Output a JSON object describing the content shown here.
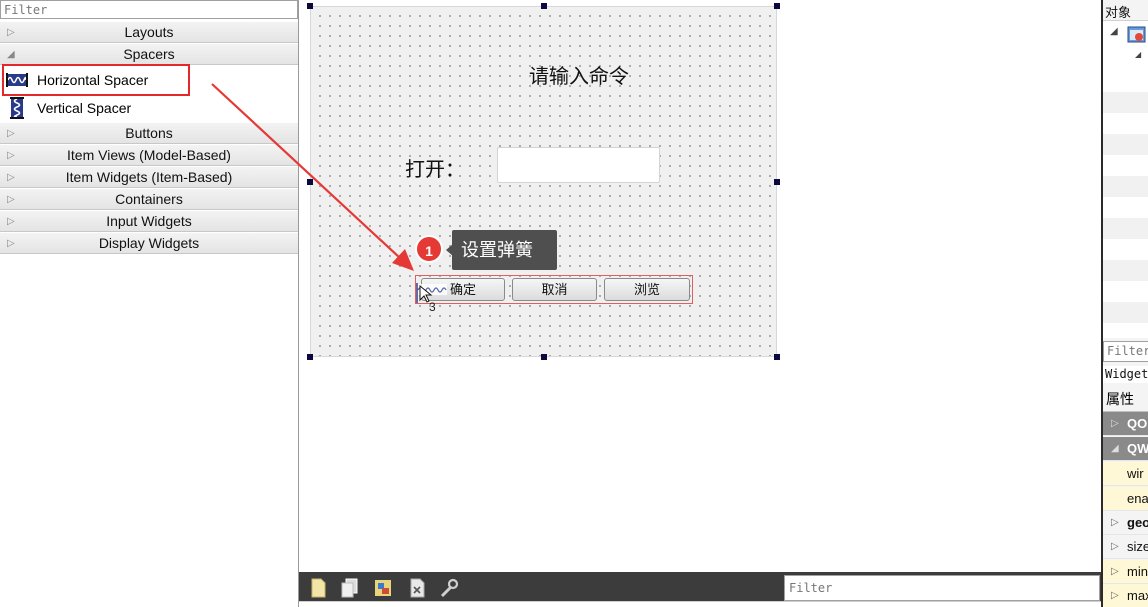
{
  "widget_box": {
    "filter_placeholder": "Filter",
    "categories": [
      {
        "label": "Layouts",
        "arrow": "▷"
      },
      {
        "label": "Spacers",
        "arrow": "◢"
      },
      {
        "label": "Buttons",
        "arrow": "▷"
      },
      {
        "label": "Item Views (Model-Based)",
        "arrow": "▷"
      },
      {
        "label": "Item Widgets (Item-Based)",
        "arrow": "▷"
      },
      {
        "label": "Containers",
        "arrow": "▷"
      },
      {
        "label": "Input Widgets",
        "arrow": "▷"
      },
      {
        "label": "Display Widgets",
        "arrow": "▷"
      }
    ],
    "spacer_items": [
      {
        "label": "Horizontal Spacer",
        "icon": "horizontal-spacer-icon"
      },
      {
        "label": "Vertical Spacer",
        "icon": "vertical-spacer-icon"
      }
    ]
  },
  "form": {
    "title": "请输入命令",
    "open_label": "打开：",
    "ok_button": "确定",
    "ok_button_partial": "确定",
    "cancel_button": "取消",
    "browse_button": "浏览",
    "drag_marker": "3"
  },
  "annotation": {
    "step": "1",
    "text": "设置弹簧",
    "color": "#e53935"
  },
  "bottom_bar": {
    "filter_placeholder": "Filter",
    "icons": [
      "new-file-icon",
      "copy-icon",
      "image-resource-icon",
      "delete-icon",
      "wrench-icon"
    ]
  },
  "object_inspector": {
    "header": "对象"
  },
  "property_editor": {
    "filter_placeholder": "Filter",
    "class_label": "Widget",
    "header": "属性",
    "rows": [
      {
        "label": "QO",
        "arrow": "▷",
        "kind": "group"
      },
      {
        "label": "QW",
        "arrow": "◢",
        "kind": "group"
      },
      {
        "label": "wir",
        "arrow": "",
        "kind": "yellow"
      },
      {
        "label": "ena",
        "arrow": "",
        "kind": "yellow"
      },
      {
        "label": "geo",
        "arrow": "▷",
        "kind": "bold"
      },
      {
        "label": "size",
        "arrow": "▷",
        "kind": "plain"
      },
      {
        "label": "min",
        "arrow": "▷",
        "kind": "yellow"
      },
      {
        "label": "max",
        "arrow": "▷",
        "kind": "yellow"
      }
    ]
  }
}
